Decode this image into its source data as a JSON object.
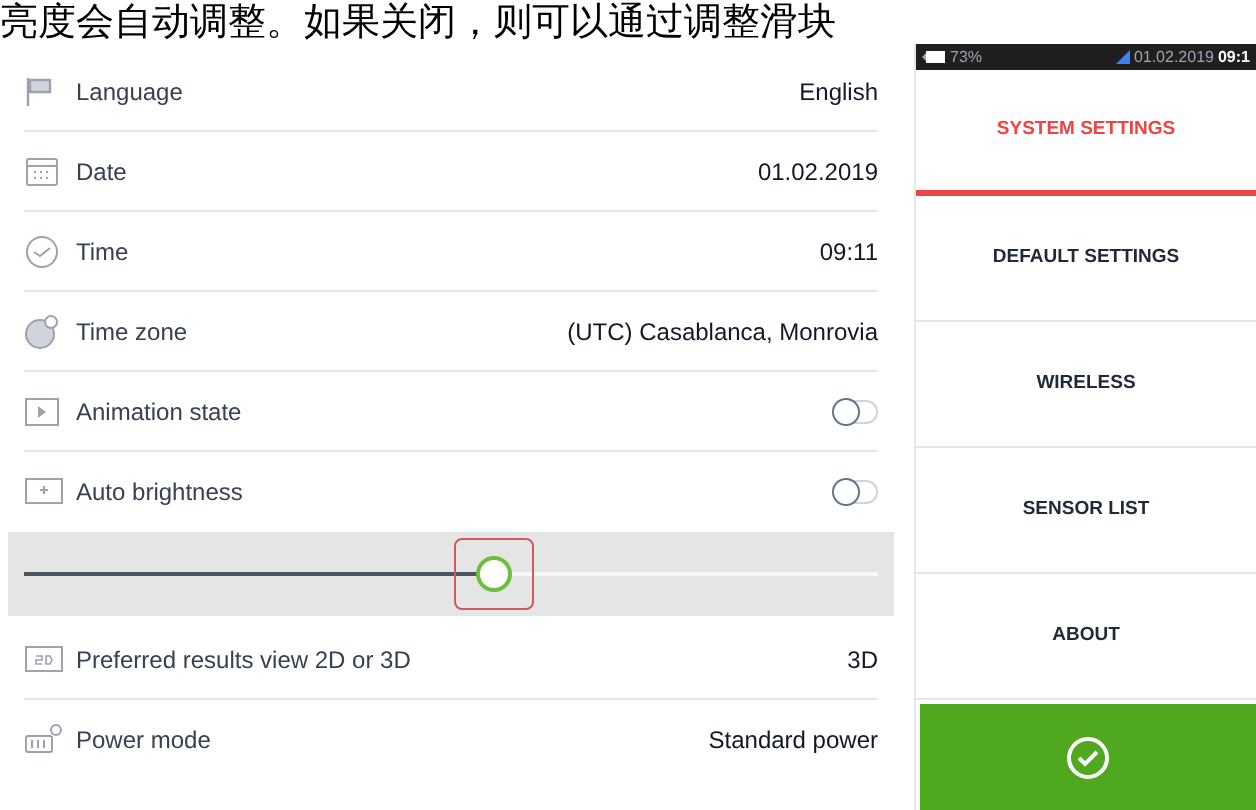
{
  "caption": "亮度会自动调整。如果关闭，则可以通过调整滑块",
  "settings": [
    {
      "kind": "value",
      "label": "Language",
      "value": "English"
    },
    {
      "kind": "value",
      "label": "Date",
      "value": "01.02.2019"
    },
    {
      "kind": "value",
      "label": "Time",
      "value": "09:11"
    },
    {
      "kind": "value",
      "label": "Time zone",
      "value": "(UTC) Casablanca, Monrovia"
    },
    {
      "kind": "toggle",
      "label": "Animation state",
      "on": false
    },
    {
      "kind": "toggle",
      "label": "Auto brightness",
      "on": false
    },
    {
      "kind": "slider",
      "level": 0.55
    },
    {
      "kind": "value",
      "label": "Preferred results view 2D or 3D",
      "value": "3D"
    },
    {
      "kind": "value",
      "label": "Power mode",
      "value": "Standard power"
    }
  ],
  "status_bar": {
    "battery": "73%",
    "date": "01.02.2019",
    "time": "09:1"
  },
  "menu": [
    {
      "label": "SYSTEM SETTINGS",
      "selected": true
    },
    {
      "label": "DEFAULT SETTINGS",
      "selected": false
    },
    {
      "label": "WIRELESS",
      "selected": false
    },
    {
      "label": "SENSOR LIST",
      "selected": false
    },
    {
      "label": "ABOUT",
      "selected": false
    }
  ]
}
